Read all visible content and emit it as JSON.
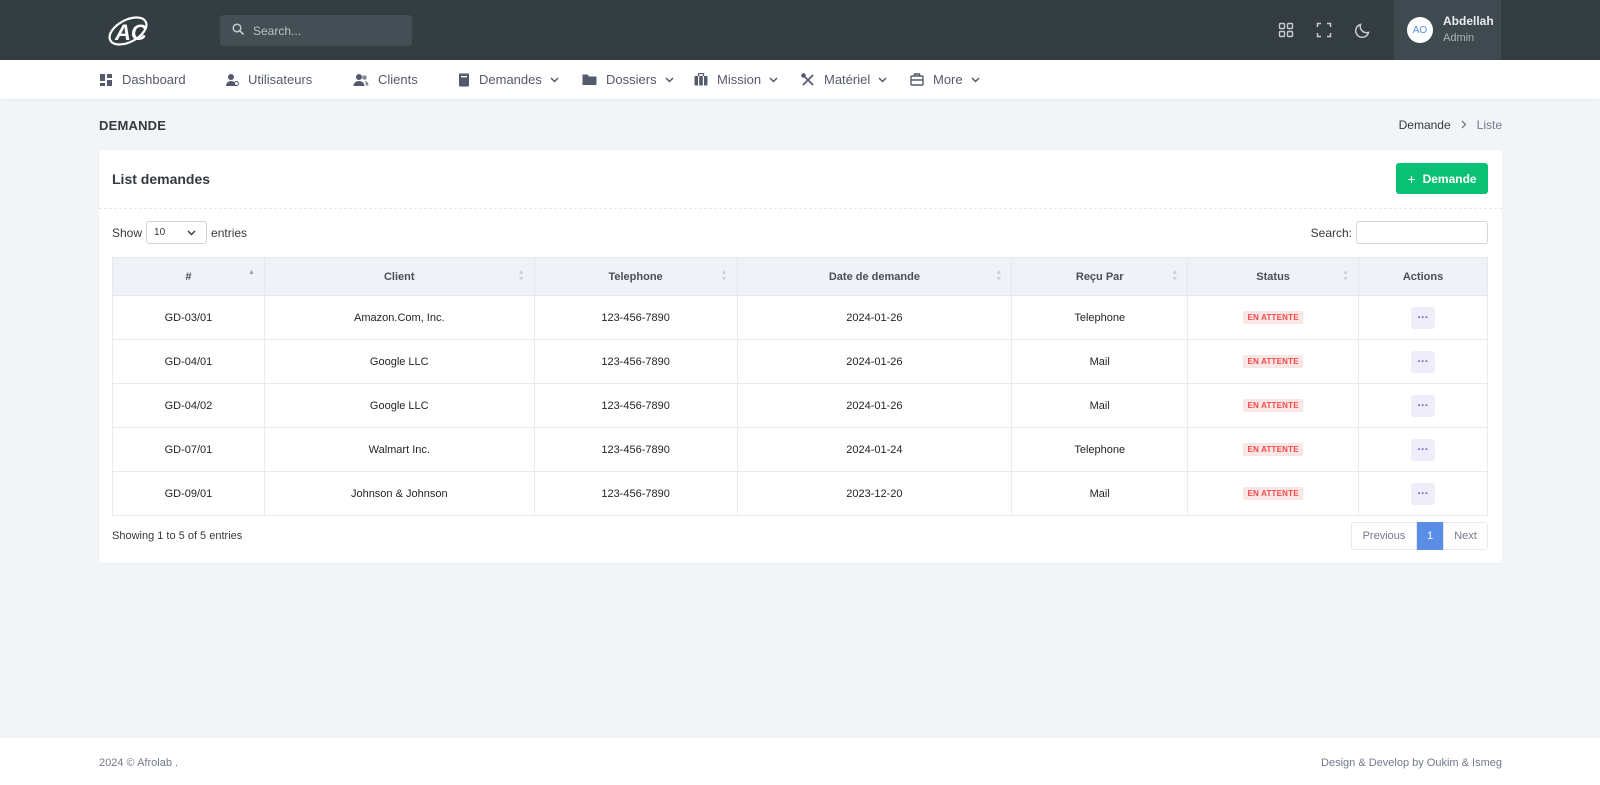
{
  "topbar": {
    "search_placeholder": "Search...",
    "icons": [
      "apps-grid-icon",
      "fullscreen-icon",
      "moon-icon"
    ],
    "user": {
      "initials": "AO",
      "name": "Abdellah",
      "role": "Admin"
    }
  },
  "nav": {
    "items": [
      {
        "label": "Dashboard",
        "icon": "dashboard-icon",
        "dropdown": false
      },
      {
        "label": "Utilisateurs",
        "icon": "user-icon",
        "dropdown": false
      },
      {
        "label": "Clients",
        "icon": "users-icon",
        "dropdown": false
      },
      {
        "label": "Demandes",
        "icon": "file-icon",
        "dropdown": true
      },
      {
        "label": "Dossiers",
        "icon": "folder-icon",
        "dropdown": true
      },
      {
        "label": "Mission",
        "icon": "briefcase-icon",
        "dropdown": true
      },
      {
        "label": "Matériel",
        "icon": "tools-icon",
        "dropdown": true
      },
      {
        "label": "More",
        "icon": "case-icon",
        "dropdown": true
      }
    ]
  },
  "page": {
    "title": "DEMANDE",
    "breadcrumb": {
      "parent": "Demande",
      "current": "Liste"
    }
  },
  "card": {
    "title": "List demandes",
    "add_button": "Demande",
    "show_label": "Show",
    "entries_value": "10",
    "entries_label": "entries",
    "search_label": "Search:",
    "table": {
      "columns": [
        "#",
        "Client",
        "Telephone",
        "Date de demande",
        "Reçu Par",
        "Status",
        "Actions"
      ],
      "rows": [
        {
          "id": "GD-03/01",
          "client": "Amazon.Com, Inc.",
          "telephone": "123-456-7890",
          "date": "2024-01-26",
          "recu_par": "Telephone",
          "status": "EN ATTENTE",
          "action": "···"
        },
        {
          "id": "GD-04/01",
          "client": "Google LLC",
          "telephone": "123-456-7890",
          "date": "2024-01-26",
          "recu_par": "Mail",
          "status": "EN ATTENTE",
          "action": "···"
        },
        {
          "id": "GD-04/02",
          "client": "Google LLC",
          "telephone": "123-456-7890",
          "date": "2024-01-26",
          "recu_par": "Mail",
          "status": "EN ATTENTE",
          "action": "···"
        },
        {
          "id": "GD-07/01",
          "client": "Walmart Inc.",
          "telephone": "123-456-7890",
          "date": "2024-01-24",
          "recu_par": "Telephone",
          "status": "EN ATTENTE",
          "action": "···"
        },
        {
          "id": "GD-09/01",
          "client": "Johnson & Johnson",
          "telephone": "123-456-7890",
          "date": "2023-12-20",
          "recu_par": "Mail",
          "status": "EN ATTENTE",
          "action": "···"
        }
      ]
    },
    "showing_text": "Showing 1 to 5 of 5 entries",
    "pagination": {
      "previous": "Previous",
      "current": "1",
      "next": "Next"
    }
  },
  "footer": {
    "left": "2024 © Afrolab .",
    "right": "Design & Develop by Oukim & Ismeg"
  },
  "colors": {
    "topbar": "#343d42",
    "accent_green": "#0ac074",
    "accent_blue": "#5a8de6",
    "status_red": "#ef4b4b"
  }
}
